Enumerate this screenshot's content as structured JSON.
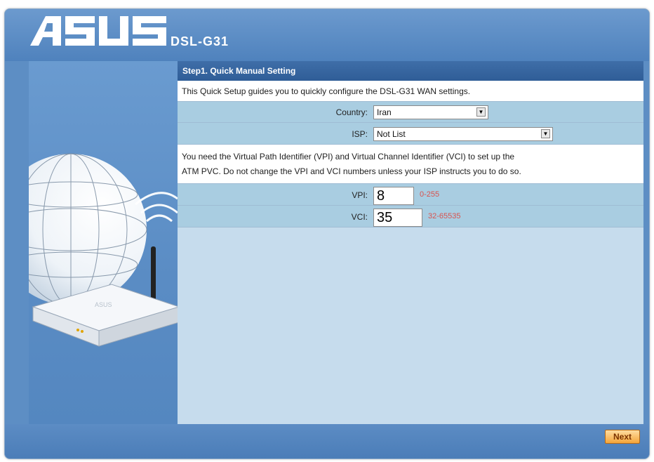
{
  "brand": {
    "logo_text": "ASUS",
    "model": "DSL-G31"
  },
  "illustration": {
    "device_label": "ASUS"
  },
  "step": {
    "title": "Step1. Quick Manual Setting"
  },
  "intro": "This Quick Setup guides you to quickly configure the DSL-G31 WAN settings.",
  "country": {
    "label": "Country:",
    "value": "Iran"
  },
  "isp": {
    "label": "ISP:",
    "value": "Not List"
  },
  "vpi_vci_note": {
    "line1": "You need the Virtual Path Identifier (VPI) and Virtual Channel Identifier (VCI) to set up the",
    "line2": "ATM PVC. Do not change the VPI and VCI numbers unless your ISP instructs you to do so."
  },
  "vpi": {
    "label": "VPI:",
    "value": "8",
    "range": "0-255"
  },
  "vci": {
    "label": "VCI:",
    "value": "35",
    "range": "32-65535"
  },
  "footer": {
    "next_label": "Next"
  },
  "colors": {
    "header": "#5d8ec4",
    "accent_range": "#d9534f",
    "next_button": "#f4a53a"
  }
}
